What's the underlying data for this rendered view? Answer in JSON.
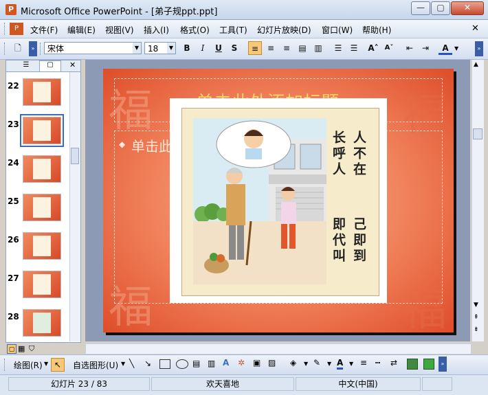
{
  "window": {
    "title": "Microsoft Office PowerPoint - [弟子规ppt.ppt]",
    "app_icon": "powerpoint-icon"
  },
  "menu": {
    "items": [
      "文件(F)",
      "编辑(E)",
      "视图(V)",
      "插入(I)",
      "格式(O)",
      "工具(T)",
      "幻灯片放映(D)",
      "窗口(W)",
      "帮助(H)"
    ]
  },
  "toolbar": {
    "font_name": "宋体",
    "font_size": "18",
    "bold": "B",
    "italic": "I",
    "underline": "U",
    "shadow": "S",
    "font_color_label": "A"
  },
  "slides_panel": {
    "numbers": [
      "22",
      "23",
      "24",
      "25",
      "26",
      "27",
      "28"
    ],
    "selected": "23"
  },
  "slide": {
    "title_placeholder": "单击此处添加标题",
    "body_placeholder": "单击此处添加文本",
    "bullet": "◆",
    "verse_right": "人不在",
    "verse_left": "长呼人",
    "verse_right2": "己即到",
    "verse_left2": "即代叫"
  },
  "drawing_toolbar": {
    "draw_label": "绘图(R)",
    "autoshapes_label": "自选图形(U)",
    "font_color_label": "A"
  },
  "status": {
    "slide_info": "幻灯片 23 / 83",
    "design": "欢天喜地",
    "language": "中文(中国)"
  }
}
